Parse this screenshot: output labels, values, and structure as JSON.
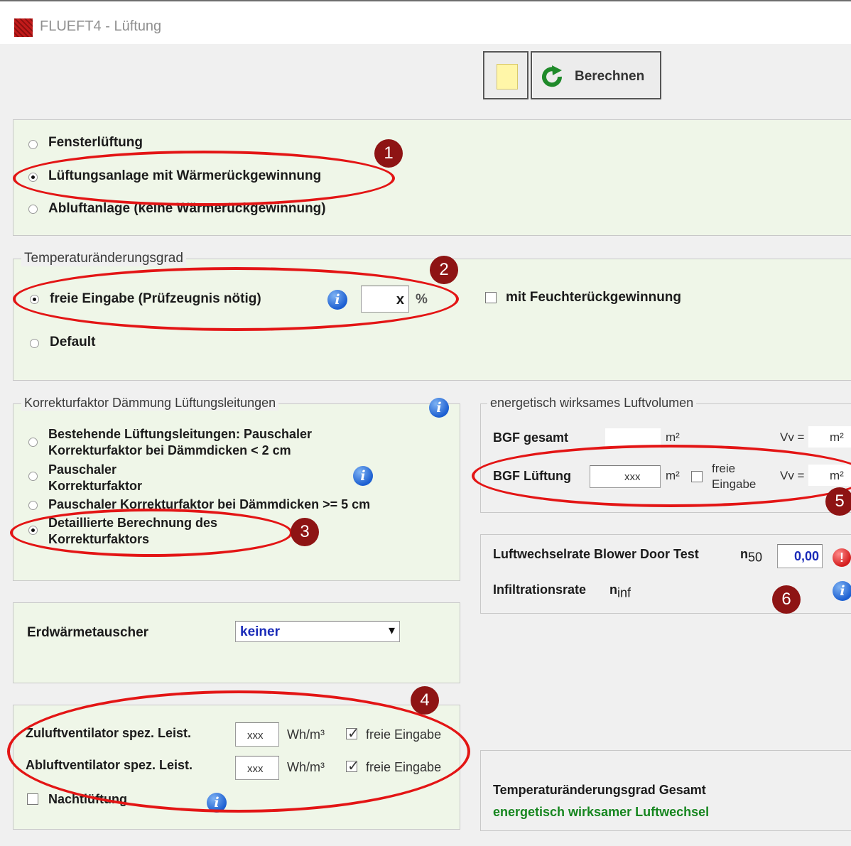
{
  "window": {
    "title": "FLUEFT4 - Lüftung"
  },
  "toolbar": {
    "new_icon": "document-icon",
    "calc_label": "Berechnen"
  },
  "ventilation_type": {
    "options": [
      {
        "label": "Fensterlüftung",
        "selected": false
      },
      {
        "label": "Lüftungsanlage mit Wärmerückgewinnung",
        "selected": true
      },
      {
        "label": "Abluftanlage (keine Wärmerückgewinnung)",
        "selected": false
      }
    ]
  },
  "temperature": {
    "legend": "Temperaturänderungsgrad",
    "free_label": "freie Eingabe (Prüfzeugnis nötig)",
    "free_value": "x",
    "unit": "%",
    "default_label": "Default",
    "humidity_label": "mit Feuchterückgewinnung"
  },
  "correction": {
    "legend": "Korrekturfaktor Dämmung Lüftungsleitungen",
    "opt1_line1": "Bestehende Lüftungsleitungen: Pauschaler",
    "opt1_line2": "Korrekturfaktor bei Dämmdicken < 2 cm",
    "opt2_line1": "Pauschaler",
    "opt2_line2": "Korrekturfaktor",
    "opt3": "Pauschaler Korrekturfaktor bei Dämmdicken >= 5 cm",
    "opt4_line1": "Detaillierte Berechnung des",
    "opt4_line2": "Korrekturfaktors"
  },
  "volume": {
    "legend": "energetisch wirksames Luftvolumen",
    "bgf_total_label": "BGF gesamt",
    "bgf_vent_label": "BGF Lüftung",
    "bgf_vent_value": "xxx",
    "unit_m2": "m²",
    "free_line1": "freie",
    "free_line2": "Eingabe",
    "vv_label": "Vv ="
  },
  "airchange": {
    "blower_label": "Luftwechselrate Blower Door Test",
    "n_symbol": "n",
    "n50_sub": "50",
    "n50_value": "0,00",
    "infiltration_label": "Infiltrationsrate",
    "ninf_sub": "inf"
  },
  "ground_hx": {
    "label": "Erdwärmetauscher",
    "selected": "keiner"
  },
  "fans": {
    "supply_label": "Zuluftventilator spez. Leist.",
    "supply_value": "xxx",
    "exhaust_label": "Abluftventilator spez. Leist.",
    "exhaust_value": "xxx",
    "unit": "Wh/m³",
    "free_label": "freie Eingabe",
    "night_label": "Nachtlüftung"
  },
  "results": {
    "temp_total_label": "Temperaturänderungsgrad Gesamt",
    "airchange_label": "energetisch wirksamer Luftwechsel"
  },
  "annotations": {
    "m1": "1",
    "m2": "2",
    "m3": "3",
    "m4": "4",
    "m5": "5",
    "m6": "6"
  },
  "colors": {
    "annotation_red": "#e31515",
    "marker": "#8e1414",
    "panel_green": "#eff6e8",
    "result_green": "#16861f"
  }
}
